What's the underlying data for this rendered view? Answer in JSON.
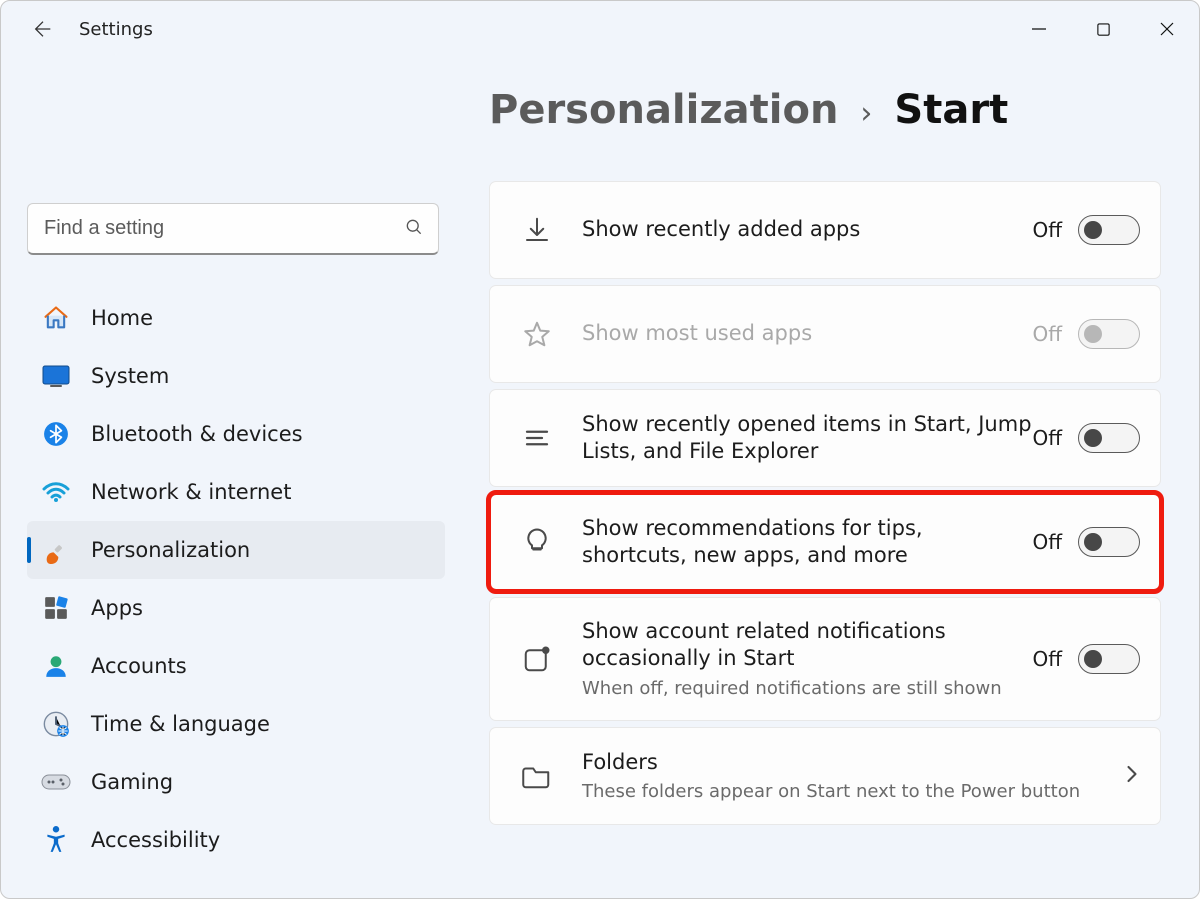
{
  "app": {
    "title": "Settings"
  },
  "search": {
    "placeholder": "Find a setting"
  },
  "sidebar": {
    "items": [
      {
        "label": "Home"
      },
      {
        "label": "System"
      },
      {
        "label": "Bluetooth & devices"
      },
      {
        "label": "Network & internet"
      },
      {
        "label": "Personalization"
      },
      {
        "label": "Apps"
      },
      {
        "label": "Accounts"
      },
      {
        "label": "Time & language"
      },
      {
        "label": "Gaming"
      },
      {
        "label": "Accessibility"
      }
    ]
  },
  "breadcrumb": {
    "parent": "Personalization",
    "separator": "›",
    "current": "Start"
  },
  "settings": [
    {
      "title": "Show recently added apps",
      "state": "Off"
    },
    {
      "title": "Show most used apps",
      "state": "Off"
    },
    {
      "title": "Show recently opened items in Start, Jump Lists, and File Explorer",
      "state": "Off"
    },
    {
      "title": "Show recommendations for tips, shortcuts, new apps, and more",
      "state": "Off"
    },
    {
      "title": "Show account related notifications occasionally in Start",
      "subtitle": "When off, required notifications are still shown",
      "state": "Off"
    },
    {
      "title": "Folders",
      "subtitle": "These folders appear on Start next to the Power button"
    }
  ]
}
